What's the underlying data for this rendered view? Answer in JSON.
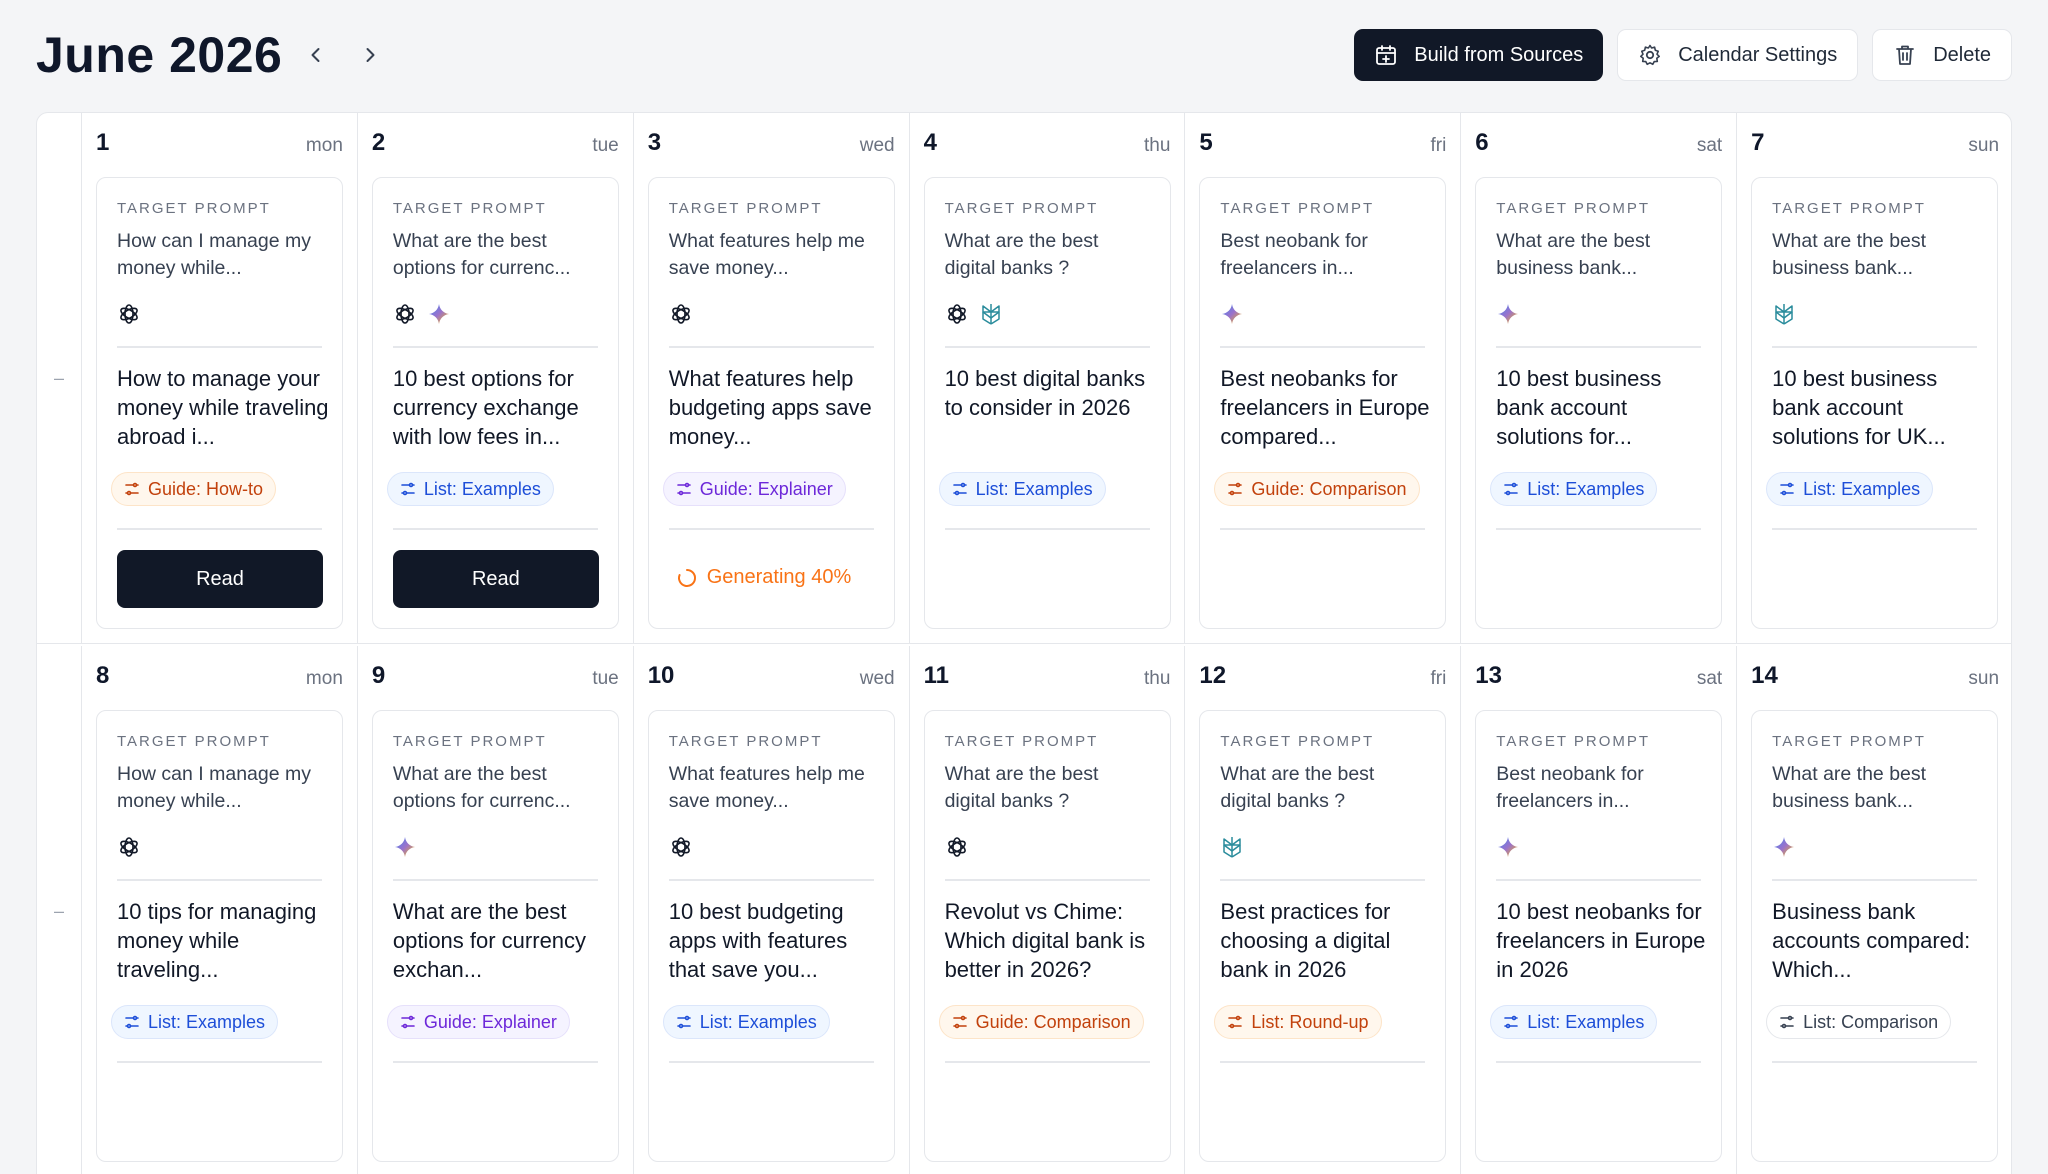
{
  "header": {
    "title": "June 2026",
    "prev_icon": "chevron-left-icon",
    "next_icon": "chevron-right-icon",
    "build_label": "Build from Sources",
    "settings_label": "Calendar Settings",
    "delete_label": "Delete"
  },
  "weeks": [
    {
      "gutter": "–",
      "days": [
        {
          "num": "1",
          "name": "mon",
          "label": "TARGET PROMPT",
          "prompt": "How can I manage my money while...",
          "icons": [
            "openai"
          ],
          "title": "How to manage your money while traveling abroad i...",
          "tag": "Guide: How-to",
          "tag_color": "orange",
          "action": "Read"
        },
        {
          "num": "2",
          "name": "tue",
          "label": "TARGET PROMPT",
          "prompt": "What are the best options for currenc...",
          "icons": [
            "openai",
            "gemini"
          ],
          "title": "10 best options for currency exchange with low fees in...",
          "tag": "List: Examples",
          "tag_color": "blue",
          "action": "Read"
        },
        {
          "num": "3",
          "name": "wed",
          "label": "TARGET PROMPT",
          "prompt": "What features help me save money...",
          "icons": [
            "openai"
          ],
          "title": "What features help budgeting apps save money...",
          "tag": "Guide: Explainer",
          "tag_color": "purple",
          "status": "Generating 40%"
        },
        {
          "num": "4",
          "name": "thu",
          "label": "TARGET PROMPT",
          "prompt": "What are the best digital banks ?",
          "icons": [
            "openai",
            "perplexity"
          ],
          "title": "10 best digital banks to consider in 2026",
          "tag": "List: Examples",
          "tag_color": "blue"
        },
        {
          "num": "5",
          "name": "fri",
          "label": "TARGET PROMPT",
          "prompt": "Best neobank for freelancers in...",
          "icons": [
            "gemini"
          ],
          "title": "Best neobanks for freelancers in Europe compared...",
          "tag": "Guide: Comparison",
          "tag_color": "orange"
        },
        {
          "num": "6",
          "name": "sat",
          "label": "TARGET PROMPT",
          "prompt": "What are the best business bank...",
          "icons": [
            "gemini"
          ],
          "title": "10 best business bank account solutions for...",
          "tag": "List: Examples",
          "tag_color": "blue"
        },
        {
          "num": "7",
          "name": "sun",
          "label": "TARGET PROMPT",
          "prompt": "What are the best business bank...",
          "icons": [
            "perplexity"
          ],
          "title": "10 best business bank account solutions for UK...",
          "tag": "List: Examples",
          "tag_color": "blue"
        }
      ]
    },
    {
      "gutter": "–",
      "days": [
        {
          "num": "8",
          "name": "mon",
          "label": "TARGET PROMPT",
          "prompt": "How can I manage my money while...",
          "icons": [
            "openai"
          ],
          "title": "10 tips for managing money while traveling...",
          "tag": "List: Examples",
          "tag_color": "blue"
        },
        {
          "num": "9",
          "name": "tue",
          "label": "TARGET PROMPT",
          "prompt": "What are the best options for currenc...",
          "icons": [
            "gemini"
          ],
          "title": "What are the best options for currency exchan...",
          "tag": "Guide: Explainer",
          "tag_color": "purple"
        },
        {
          "num": "10",
          "name": "wed",
          "label": "TARGET PROMPT",
          "prompt": "What features help me save money...",
          "icons": [
            "openai"
          ],
          "title": "10 best budgeting apps with features that save you...",
          "tag": "List: Examples",
          "tag_color": "blue"
        },
        {
          "num": "11",
          "name": "thu",
          "label": "TARGET PROMPT",
          "prompt": "What are the best digital banks ?",
          "icons": [
            "openai"
          ],
          "title": "Revolut vs Chime: Which digital bank is better in 2026?",
          "tag": "Guide: Comparison",
          "tag_color": "orange"
        },
        {
          "num": "12",
          "name": "fri",
          "label": "TARGET PROMPT",
          "prompt": "What are the best digital banks ?",
          "icons": [
            "perplexity"
          ],
          "title": "Best practices for choosing a digital bank in 2026",
          "tag": "List: Round-up",
          "tag_color": "orange"
        },
        {
          "num": "13",
          "name": "sat",
          "label": "TARGET PROMPT",
          "prompt": "Best neobank for freelancers in...",
          "icons": [
            "gemini"
          ],
          "title": "10 best neobanks for freelancers in Europe in 2026",
          "tag": "List: Examples",
          "tag_color": "blue"
        },
        {
          "num": "14",
          "name": "sun",
          "label": "TARGET PROMPT",
          "prompt": "What are the best business bank...",
          "icons": [
            "gemini"
          ],
          "title": "Business bank accounts compared: Which...",
          "tag": "List: Comparison",
          "tag_color": "gray"
        }
      ]
    }
  ]
}
